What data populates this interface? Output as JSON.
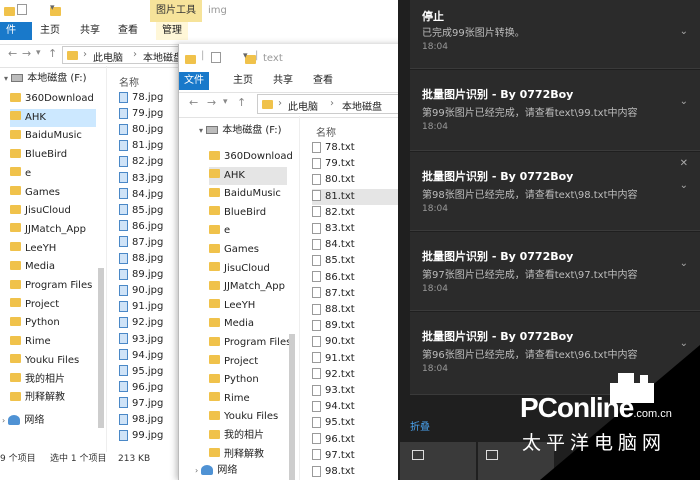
{
  "win1": {
    "title": "img",
    "tabs": {
      "file": "件",
      "home": "主页",
      "share": "共享",
      "view": "查看",
      "ctx_group": "图片工具",
      "ctx": "管理"
    },
    "address": [
      "此电脑",
      "本地磁盘"
    ],
    "tree_drive": "本地磁盘 (F:)",
    "tree": [
      "360Download",
      "AHK",
      "BaiduMusic",
      "BlueBird",
      "e",
      "Games",
      "JisuCloud",
      "JJMatch_App",
      "LeeYH",
      "Media",
      "Program Files",
      "Project",
      "Python",
      "Rime",
      "Youku Files",
      "我的相片",
      "刑释解教"
    ],
    "network": "网络",
    "col_name": "名称",
    "files": [
      "78.jpg",
      "79.jpg",
      "80.jpg",
      "81.jpg",
      "82.jpg",
      "83.jpg",
      "84.jpg",
      "85.jpg",
      "86.jpg",
      "87.jpg",
      "88.jpg",
      "89.jpg",
      "90.jpg",
      "91.jpg",
      "92.jpg",
      "93.jpg",
      "94.jpg",
      "95.jpg",
      "96.jpg",
      "97.jpg",
      "98.jpg",
      "99.jpg"
    ],
    "status": {
      "count": "9 个项目",
      "selected": "选中 1 个项目",
      "size": "213 KB"
    }
  },
  "win2": {
    "title": "text",
    "tabs": {
      "file": "文件",
      "home": "主页",
      "share": "共享",
      "view": "查看"
    },
    "address": [
      "此电脑",
      "本地磁盘"
    ],
    "tree_drive": "本地磁盘 (F:)",
    "tree": [
      "360Download",
      "AHK",
      "BaiduMusic",
      "BlueBird",
      "e",
      "Games",
      "JisuCloud",
      "JJMatch_App",
      "LeeYH",
      "Media",
      "Program Files",
      "Project",
      "Python",
      "Rime",
      "Youku Files",
      "我的相片",
      "刑释解教"
    ],
    "network": "网络",
    "col_name": "名称",
    "files": [
      "78.txt",
      "79.txt",
      "80.txt",
      "81.txt",
      "82.txt",
      "83.txt",
      "84.txt",
      "85.txt",
      "86.txt",
      "87.txt",
      "88.txt",
      "89.txt",
      "90.txt",
      "91.txt",
      "92.txt",
      "93.txt",
      "94.txt",
      "95.txt",
      "96.txt",
      "97.txt",
      "98.txt"
    ]
  },
  "notifications": [
    {
      "title": "停止",
      "body": "已完成99张图片转换。",
      "time": "18:04"
    },
    {
      "title": "批量图片识别 - By 0772Boy",
      "body": "第99张图片已经完成，请查看text\\99.txt中内容",
      "time": "18:04"
    },
    {
      "title": "批量图片识别 - By 0772Boy",
      "body": "第98张图片已经完成，请查看text\\98.txt中内容",
      "time": "18:04"
    },
    {
      "title": "批量图片识别 - By 0772Boy",
      "body": "第97张图片已经完成，请查看text\\97.txt中内容",
      "time": "18:04"
    },
    {
      "title": "批量图片识别 - By 0772Boy",
      "body": "第96张图片已经完成，请查看text\\96.txt中内容",
      "time": "18:04"
    }
  ],
  "action_center": {
    "collapse": "折叠"
  },
  "watermark": {
    "brand": "PConline",
    "domain": ".com.cn",
    "tagline": "太平洋电脑网"
  },
  "colors": {
    "accent": "#1979ca",
    "panel": "#1f1f1f",
    "card": "#2b2b2b",
    "selection": "#cce8ff"
  }
}
